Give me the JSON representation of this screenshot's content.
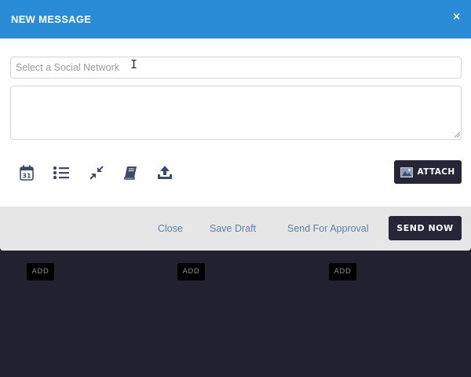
{
  "modal": {
    "title": "NEW MESSAGE",
    "close_symbol": "×",
    "network_placeholder": "Select a Social Network",
    "toolbar_icons": [
      "calendar-icon",
      "list-icon",
      "collapse-arrows-icon",
      "book-icon",
      "upload-icon"
    ],
    "calendar_day": "31",
    "attach_label": "ATTACH",
    "attach_icon": "image-icon"
  },
  "footer": {
    "close_label": "Close",
    "save_draft_label": "Save Draft",
    "approval_label": "Send For Approval",
    "send_now_label": "SEND NOW"
  },
  "background": {
    "add_buttons": [
      "ADD",
      "ADD",
      "ADD"
    ]
  },
  "colors": {
    "header": "#2a8bd7",
    "dark": "#262638",
    "page_bg": "#21212f",
    "footer_bg": "#e6e6e6",
    "link": "#5f81a8",
    "icon": "#3d4a6b"
  }
}
